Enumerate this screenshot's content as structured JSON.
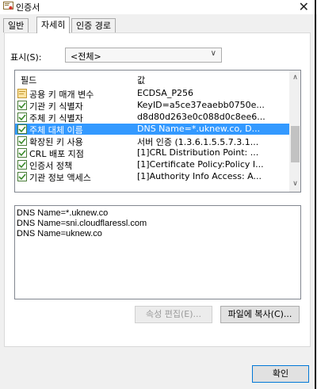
{
  "window": {
    "title": "인증서",
    "close_icon": "close-icon"
  },
  "tabs": [
    {
      "label": "일반",
      "active": false
    },
    {
      "label": "자세히",
      "active": true
    },
    {
      "label": "인증 경로",
      "active": false
    }
  ],
  "show": {
    "label": "표시(S):",
    "selected": "<전체>"
  },
  "list": {
    "headers": {
      "field": "필드",
      "value": "값"
    },
    "rows": [
      {
        "field": "공용 키 매개 변수",
        "value": "ECDSA_P256",
        "icon": "document-icon",
        "selected": false
      },
      {
        "field": "기관 키 식별자",
        "value": "KeyID=a5ce37eaebb0750e...",
        "icon": "certificate-extension-icon",
        "selected": false
      },
      {
        "field": "주체 키 식별자",
        "value": "d8d80d263e0c088d0c8ee6...",
        "icon": "certificate-extension-icon",
        "selected": false
      },
      {
        "field": "주체 대체 이름",
        "value": "DNS Name=*.uknew.co, D...",
        "icon": "certificate-extension-icon",
        "selected": true
      },
      {
        "field": "확장된 키 사용",
        "value": "서버 인증 (1.3.6.1.5.5.7.3.1...",
        "icon": "certificate-extension-icon",
        "selected": false
      },
      {
        "field": "CRL 배포 지점",
        "value": "[1]CRL Distribution Point: ...",
        "icon": "certificate-extension-icon",
        "selected": false
      },
      {
        "field": "인증서 정책",
        "value": "[1]Certificate Policy:Policy I...",
        "icon": "certificate-extension-icon",
        "selected": false
      },
      {
        "field": "기관 정보 액세스",
        "value": "[1]Authority Info Access: A...",
        "icon": "certificate-extension-icon",
        "selected": false
      }
    ]
  },
  "detail_lines": [
    "DNS Name=*.uknew.co",
    "DNS Name=sni.cloudflaressl.com",
    "DNS Name=uknew.co"
  ],
  "buttons": {
    "edit_properties": "속성 편집(E)...",
    "copy_to_file": "파일에 복사(C)...",
    "ok": "확인"
  },
  "colors": {
    "selection": "#3399ff",
    "ok_border": "#0078d7"
  }
}
